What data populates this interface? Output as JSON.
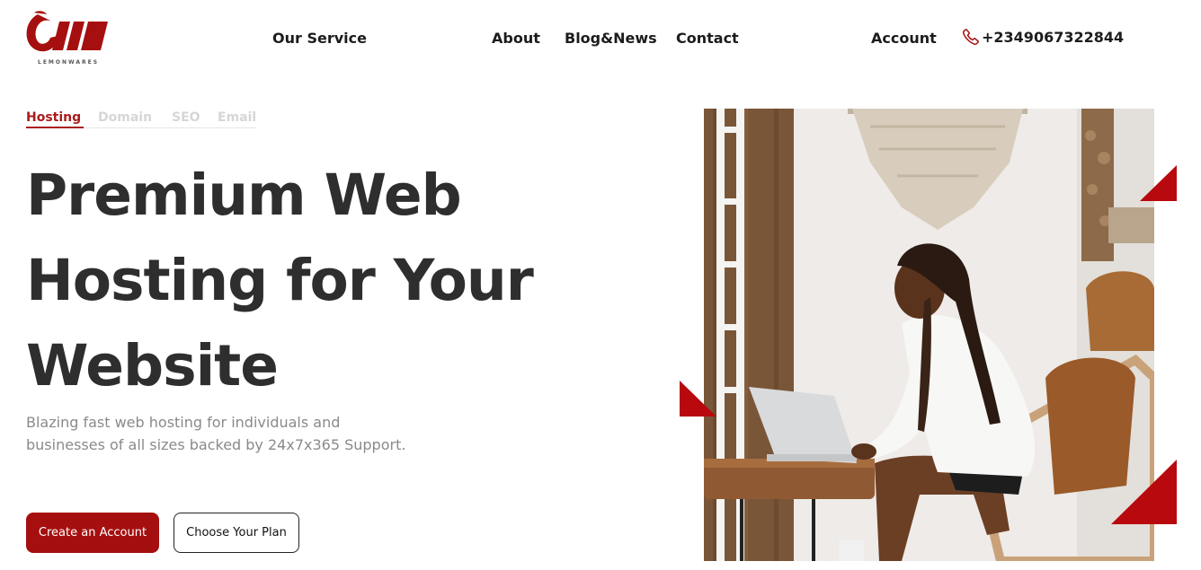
{
  "header": {
    "logo_text": "LEMONWARES",
    "nav": {
      "service": "Our Service",
      "about": "About",
      "blog": "Blog&News",
      "contact": "Contact",
      "account": "Account"
    },
    "phone": "+2349067322844"
  },
  "tabs": [
    {
      "label": "Hosting",
      "active": true
    },
    {
      "label": "Domain",
      "active": false
    },
    {
      "label": "SEO",
      "active": false
    },
    {
      "label": "Email",
      "active": false
    }
  ],
  "hero": {
    "title_line1": "Premium Web",
    "title_line2": "Hosting for Your",
    "title_line3": "Website",
    "subtitle_line1": "Blazing fast web hosting for individuals and",
    "subtitle_line2": "businesses of all sizes backed by 24x7x365 Support.",
    "primary_button": "Create an Account",
    "secondary_button": "Choose Your Plan"
  },
  "colors": {
    "brand": "#a60f0f",
    "text": "#2e2e2e",
    "muted": "#8a8a8a"
  }
}
